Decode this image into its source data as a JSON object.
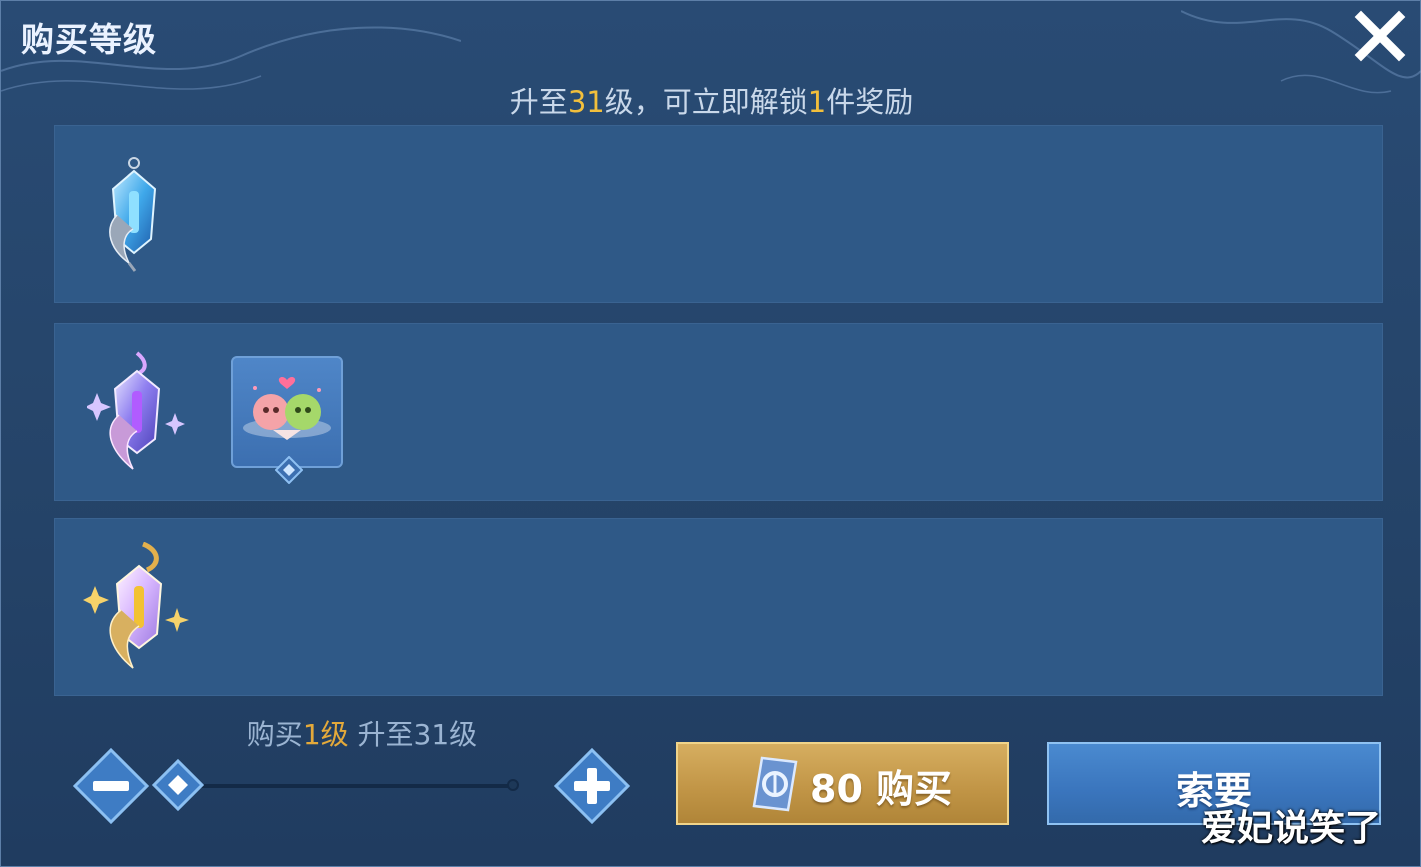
{
  "dialog": {
    "title": "购买等级",
    "subtitle": {
      "prefix": "升至",
      "level": "31",
      "middle": "级，可立即解锁",
      "count": "1",
      "suffix": "件奖励"
    }
  },
  "reward_rows": [
    {
      "tier_icon": "blue-crystal-icon",
      "rewards": []
    },
    {
      "tier_icon": "purple-crystal-icon",
      "rewards": [
        "emote-card-icon"
      ]
    },
    {
      "tier_icon": "gold-crystal-icon",
      "rewards": []
    }
  ],
  "purchase": {
    "buy_prefix": "购买",
    "buy_count": "1级",
    "target": "升至31级",
    "slider_fraction": 0.0
  },
  "buttons": {
    "buy_label": "80 购买",
    "ask_label": "索要"
  },
  "watermark": "爱妃说笑了",
  "colors": {
    "highlight": "#f2bf3c",
    "buy_button": "#c29647",
    "ask_button": "#3a75bd"
  }
}
